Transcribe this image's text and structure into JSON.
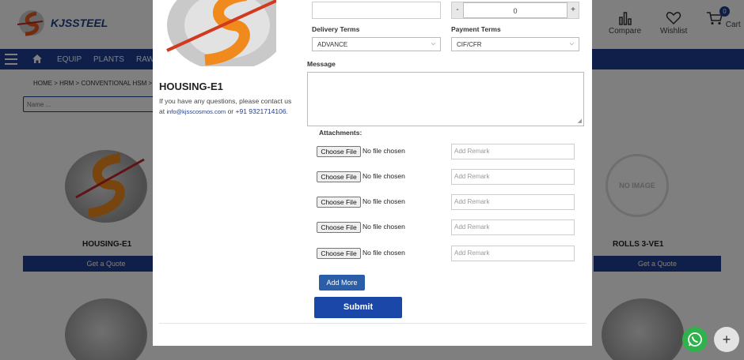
{
  "header": {
    "brand": "KJSSTEEL",
    "compare_label": "Compare",
    "wishlist_label": "Wishlist",
    "cart_label": "Cart",
    "cart_count": "0"
  },
  "nav": {
    "items": [
      "EQUIP",
      "PLANTS",
      "RAW"
    ]
  },
  "breadcrumb": "HOME > HRM > CONVENTIONAL HSM > V",
  "search": {
    "placeholder": "Name ..."
  },
  "products": [
    {
      "title": "HOUSING-E1",
      "button": "Get a Quote"
    },
    {
      "title": "ROLLS 3-VE1",
      "button": "Get a Quote",
      "image_text": "NO IMAGE"
    }
  ],
  "modal": {
    "product_title": "HOUSING-E1",
    "help_text_1": "If you have any questions, please contact us at",
    "help_email": "info@kjsscosmos.com",
    "help_or": "or",
    "help_phone": "+91 9321714106.",
    "quantity": {
      "minus": "-",
      "value": "0",
      "plus": "+"
    },
    "delivery_terms": {
      "label": "Delivery Terms",
      "value": "ADVANCE"
    },
    "payment_terms": {
      "label": "Payment Terms",
      "value": "CIF/CFR"
    },
    "message_label": "Message",
    "attachments_label": "Attachments:",
    "attachments": [
      {
        "button": "Choose File",
        "status": "No file chosen",
        "remark_placeholder": "Add Remark"
      },
      {
        "button": "Choose File",
        "status": "No file chosen",
        "remark_placeholder": "Add Remark"
      },
      {
        "button": "Choose File",
        "status": "No file chosen",
        "remark_placeholder": "Add Remark"
      },
      {
        "button": "Choose File",
        "status": "No file chosen",
        "remark_placeholder": "Add Remark"
      },
      {
        "button": "Choose File",
        "status": "No file chosen",
        "remark_placeholder": "Add Remark"
      }
    ],
    "add_more_label": "Add More",
    "submit_label": "Submit"
  },
  "colors": {
    "brand_blue": "#203e93",
    "submit_blue": "#1a47a8",
    "whatsapp_green": "#2fb24c"
  }
}
